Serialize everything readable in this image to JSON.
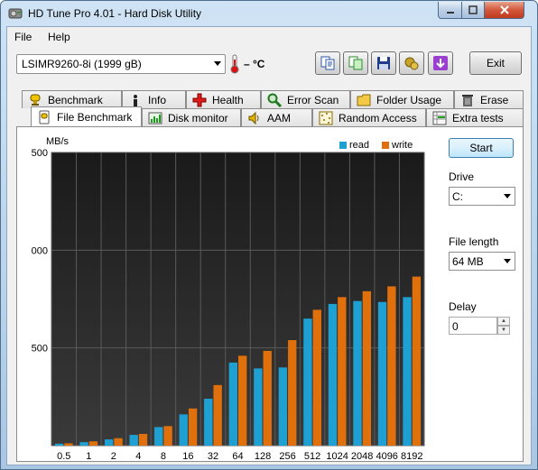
{
  "window": {
    "title": "HD Tune Pro 4.01 - Hard Disk Utility",
    "controls": [
      "minimize",
      "maximize",
      "close"
    ]
  },
  "menu": {
    "file": "File",
    "help": "Help"
  },
  "toolbar": {
    "drive": "LSIMR9260-8i (1999 gB)",
    "temperature": "– °C",
    "icons": [
      "copy-info-icon",
      "copy-screenshot-icon",
      "save-icon",
      "options-icon",
      "down-arrow-icon"
    ],
    "exit_label": "Exit"
  },
  "tabs_top": [
    {
      "label": "Benchmark",
      "icon": "benchmark-icon"
    },
    {
      "label": "Info",
      "icon": "info-icon"
    },
    {
      "label": "Health",
      "icon": "health-icon"
    },
    {
      "label": "Error Scan",
      "icon": "error-scan-icon"
    },
    {
      "label": "Folder Usage",
      "icon": "folder-icon"
    },
    {
      "label": "Erase",
      "icon": "erase-icon"
    }
  ],
  "tabs_bottom": [
    {
      "label": "File Benchmark",
      "icon": "file-benchmark-icon",
      "active": true
    },
    {
      "label": "Disk monitor",
      "icon": "disk-monitor-icon"
    },
    {
      "label": "AAM",
      "icon": "aam-icon"
    },
    {
      "label": "Random Access",
      "icon": "random-access-icon"
    },
    {
      "label": "Extra tests",
      "icon": "extra-tests-icon"
    }
  ],
  "side": {
    "start_label": "Start",
    "drive_label": "Drive",
    "drive_value": "C:",
    "file_length_label": "File length",
    "file_length_value": "64 MB",
    "delay_label": "Delay",
    "delay_value": "0"
  },
  "colors": {
    "read": "#1ea0d2",
    "write": "#e0700c",
    "plot_bg": "#2a2a2a"
  },
  "chart_data": {
    "type": "bar",
    "ylabel": "MB/s",
    "y_tick_labels": [
      "500",
      "000",
      "500"
    ],
    "ylim": [
      0,
      1500
    ],
    "categories": [
      "0.5",
      "1",
      "2",
      "4",
      "8",
      "16",
      "32",
      "64",
      "128",
      "256",
      "512",
      "1024",
      "2048",
      "4096",
      "8192"
    ],
    "series": [
      {
        "name": "read",
        "values": [
          10,
          18,
          32,
          55,
          95,
          160,
          240,
          425,
          395,
          400,
          650,
          725,
          740,
          735,
          760
        ]
      },
      {
        "name": "write",
        "values": [
          12,
          22,
          38,
          60,
          100,
          190,
          310,
          460,
          485,
          540,
          695,
          760,
          790,
          815,
          865
        ]
      }
    ],
    "legend": "top-right",
    "grid": true
  }
}
